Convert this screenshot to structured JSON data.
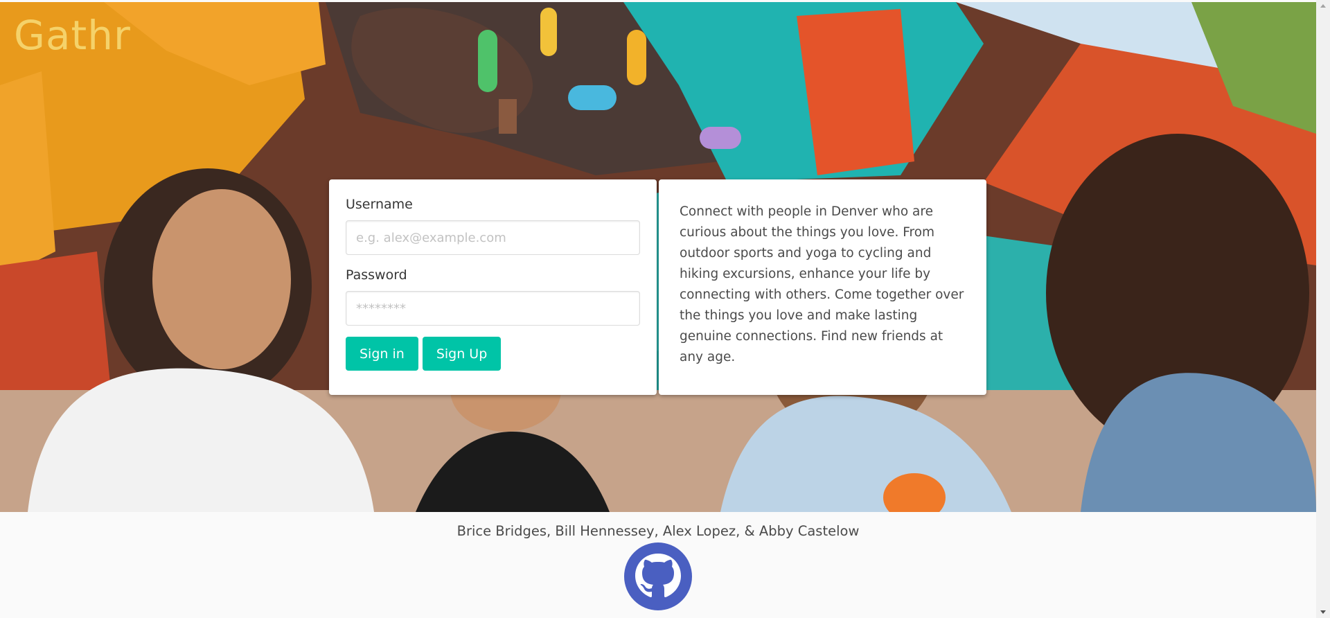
{
  "brand": {
    "name": "Gathr"
  },
  "login": {
    "username_label": "Username",
    "username_placeholder": "e.g. alex@example.com",
    "password_label": "Password",
    "password_placeholder": "********",
    "signin_label": "Sign in",
    "signup_label": "Sign Up"
  },
  "about": {
    "text": "Connect with people in Denver who are curious about the things you love. From outdoor sports and yoga to cycling and hiking excursions, enhance your life by connecting with others. Come together over the things you love and make lasting genuine connections. Find new friends at any age."
  },
  "footer": {
    "authors": "Brice Bridges, Bill Hennessey, Alex Lopez, & Abby Castelow",
    "github_icon": "github-icon"
  },
  "colors": {
    "brand": "#f5d26a",
    "accent": "#00c4a7",
    "github": "#4a5fc1"
  }
}
